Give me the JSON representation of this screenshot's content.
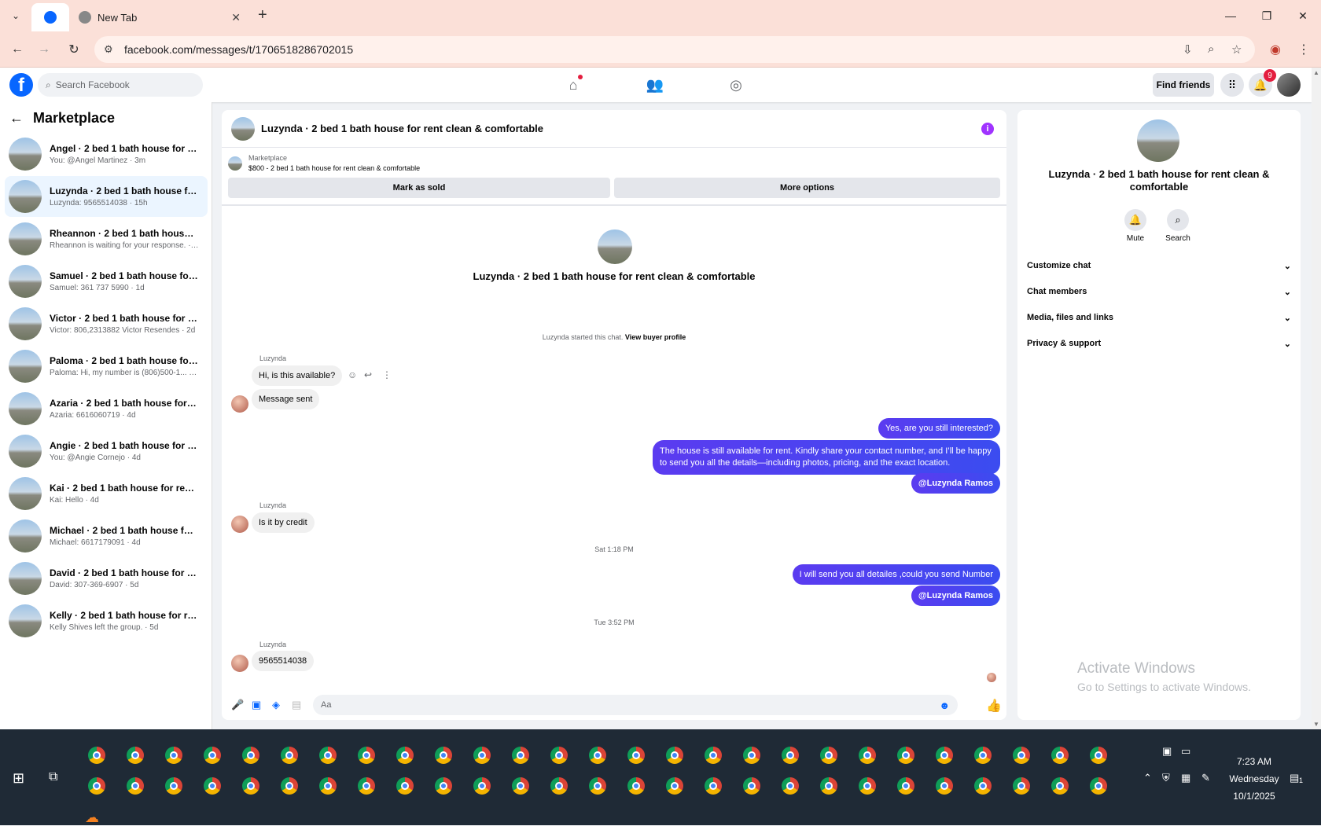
{
  "browser": {
    "tabs": [
      {
        "label": ""
      },
      {
        "label": "New Tab"
      }
    ],
    "url": "facebook.com/messages/t/1706518286702015"
  },
  "fb": {
    "search_placeholder": "Search Facebook",
    "find_friends": "Find friends",
    "notif_count": "9"
  },
  "sidebar": {
    "title": "Marketplace",
    "conversations": [
      {
        "name": "Angel · 2 bed 1 bath house for rent...",
        "preview": "You: @Angel Martinez · 3m"
      },
      {
        "name": "Luzynda · 2 bed 1 bath house for r...",
        "preview": "Luzynda: 9565514038 · 15h"
      },
      {
        "name": "Rheannon · 2 bed 1 bath house for...",
        "preview": "Rheannon is waiting for your response. · 1d"
      },
      {
        "name": "Samuel · 2 bed 1 bath house for re...",
        "preview": "Samuel: 361 737 5990 · 1d"
      },
      {
        "name": "Victor · 2 bed 1 bath house for ren...",
        "preview": "Victor: 806,2313882 Victor Resendes · 2d"
      },
      {
        "name": "Paloma · 2 bed 1 bath house for re...",
        "preview": "Paloma: Hi, my number is (806)500-1... · 3d"
      },
      {
        "name": "Azaria · 2 bed 1 bath house for ren...",
        "preview": "Azaria: 6616060719 · 4d"
      },
      {
        "name": "Angie · 2 bed 1 bath house for rent...",
        "preview": "You: @Angie Cornejo · 4d"
      },
      {
        "name": "Kai · 2 bed 1 bath house for rent cl...",
        "preview": "Kai: Hello · 4d"
      },
      {
        "name": "Michael · 2 bed 1 bath house for re...",
        "preview": "Michael: 6617179091 · 4d"
      },
      {
        "name": "David · 2 bed 1 bath house for rent...",
        "preview": "David: 307-369-6907 · 5d"
      },
      {
        "name": "Kelly · 2 bed 1 bath house for rent ...",
        "preview": "Kelly Shives left the group. · 5d"
      }
    ]
  },
  "chat": {
    "title": "Luzynda · 2 bed 1 bath house for rent clean & comfortable",
    "marketplace_label": "Marketplace",
    "listing": "$800 - 2 bed 1 bath house for rent clean & comfortable",
    "mark_sold": "Mark as sold",
    "more_options": "More options",
    "center_title": "Luzynda · 2 bed 1 bath house for rent clean & comfortable",
    "started_text": "Luzynda started this chat.",
    "view_buyer": "View buyer profile",
    "messages": {
      "sender": "Luzynda",
      "m1": "Hi, is this available?",
      "m2": "Message sent",
      "o1": "Yes, are you still interested?",
      "o2": "The house is still available for rent. Kindly share your contact number, and I’ll be happy to send you all the details—including photos, pricing, and the exact location.",
      "o3": "@Luzynda Ramos",
      "m3": "Is it by credit",
      "t1": "Sat 1:18 PM",
      "o4": "I will send you all detailes ,could you send Number",
      "o5": "@Luzynda Ramos",
      "t2": "Tue 3:52 PM",
      "m4": "9565514038"
    },
    "composer_placeholder": "Aa"
  },
  "right_panel": {
    "title": "Luzynda · 2 bed 1 bath house for rent clean & comfortable",
    "mute": "Mute",
    "search": "Search",
    "sections": [
      "Customize chat",
      "Chat members",
      "Media, files and links",
      "Privacy & support"
    ]
  },
  "watermark": {
    "line1": "Activate Windows",
    "line2": "Go to Settings to activate Windows."
  },
  "taskbar": {
    "time": "7:23 AM",
    "day": "Wednesday",
    "date": "10/1/2025",
    "notif": "1"
  },
  "colors": {
    "fb_blue": "#0866ff",
    "bubble_out": "#4b3ff0",
    "tab_bar": "#fbe0d8",
    "taskbar": "#1f2a36"
  }
}
